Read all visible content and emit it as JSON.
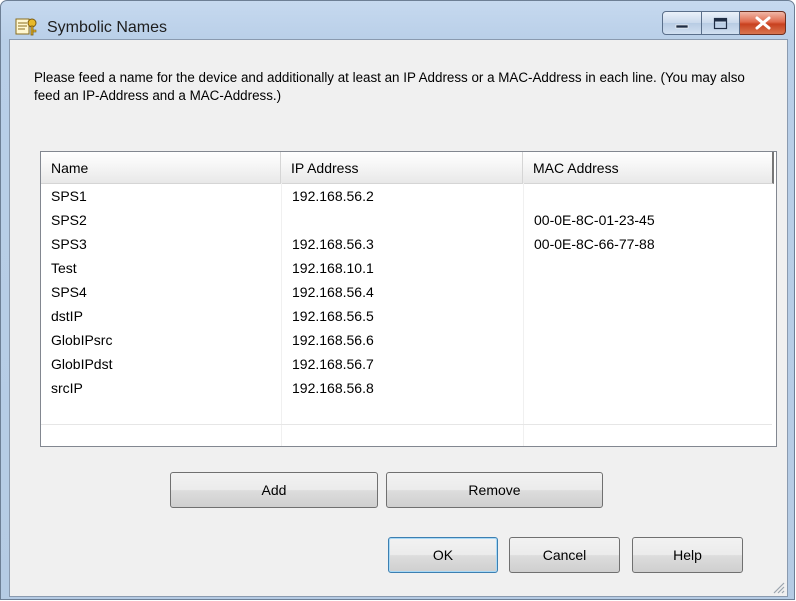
{
  "window": {
    "title": "Symbolic Names"
  },
  "description": "Please feed a name for the device and additionally at least an IP Address or a MAC-Address in each line. (You may also feed an IP-Address and a MAC-Address.)",
  "table": {
    "columns": [
      "Name",
      "IP Address",
      "MAC Address"
    ],
    "rows": [
      {
        "name": "SPS1",
        "ip": "192.168.56.2",
        "mac": ""
      },
      {
        "name": "SPS2",
        "ip": "",
        "mac": "00-0E-8C-01-23-45"
      },
      {
        "name": "SPS3",
        "ip": "192.168.56.3",
        "mac": "00-0E-8C-66-77-88"
      },
      {
        "name": "Test",
        "ip": "192.168.10.1",
        "mac": ""
      },
      {
        "name": "SPS4",
        "ip": "192.168.56.4",
        "mac": ""
      },
      {
        "name": "dstIP",
        "ip": "192.168.56.5",
        "mac": ""
      },
      {
        "name": "GlobIPsrc",
        "ip": "192.168.56.6",
        "mac": ""
      },
      {
        "name": "GlobIPdst",
        "ip": "192.168.56.7",
        "mac": ""
      },
      {
        "name": "srcIP",
        "ip": "192.168.56.8",
        "mac": ""
      }
    ]
  },
  "buttons": {
    "add": "Add",
    "remove": "Remove",
    "ok": "OK",
    "cancel": "Cancel",
    "help": "Help"
  },
  "icons": {
    "app": "key-card-icon",
    "minimize": "minimize-icon",
    "maximize": "maximize-icon",
    "close": "close-icon",
    "resize": "resize-grip-icon"
  }
}
